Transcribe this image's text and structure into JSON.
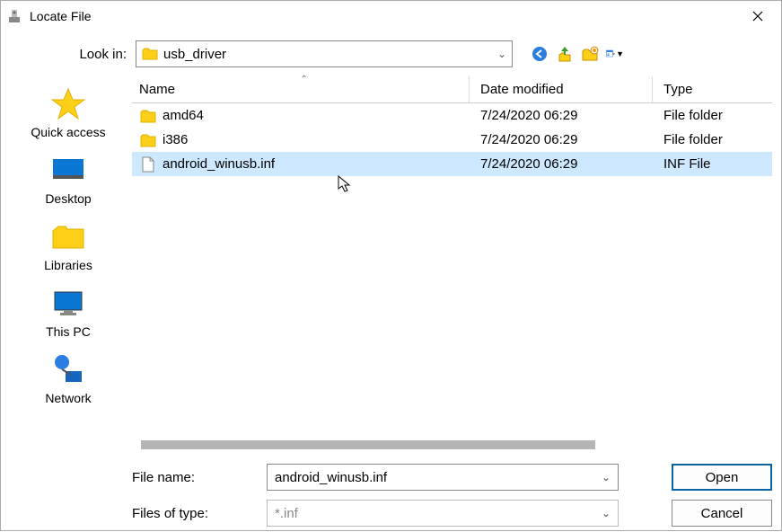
{
  "window": {
    "title": "Locate File"
  },
  "lookin": {
    "label": "Look in:",
    "value": "usb_driver"
  },
  "places": [
    {
      "name": "quick-access",
      "label": "Quick access"
    },
    {
      "name": "desktop",
      "label": "Desktop"
    },
    {
      "name": "libraries",
      "label": "Libraries"
    },
    {
      "name": "this-pc",
      "label": "This PC"
    },
    {
      "name": "network",
      "label": "Network"
    }
  ],
  "columns": {
    "name": "Name",
    "date": "Date modified",
    "type": "Type"
  },
  "rows": [
    {
      "icon": "folder",
      "name": "amd64",
      "date": "7/24/2020 06:29",
      "type": "File folder",
      "selected": false
    },
    {
      "icon": "folder",
      "name": "i386",
      "date": "7/24/2020 06:29",
      "type": "File folder",
      "selected": false
    },
    {
      "icon": "file",
      "name": "android_winusb.inf",
      "date": "7/24/2020 06:29",
      "type": "INF File",
      "selected": true
    }
  ],
  "filename": {
    "label": "File name:",
    "value": "android_winusb.inf"
  },
  "filetype": {
    "label": "Files of type:",
    "value": "*.inf"
  },
  "buttons": {
    "open": "Open",
    "cancel": "Cancel"
  }
}
